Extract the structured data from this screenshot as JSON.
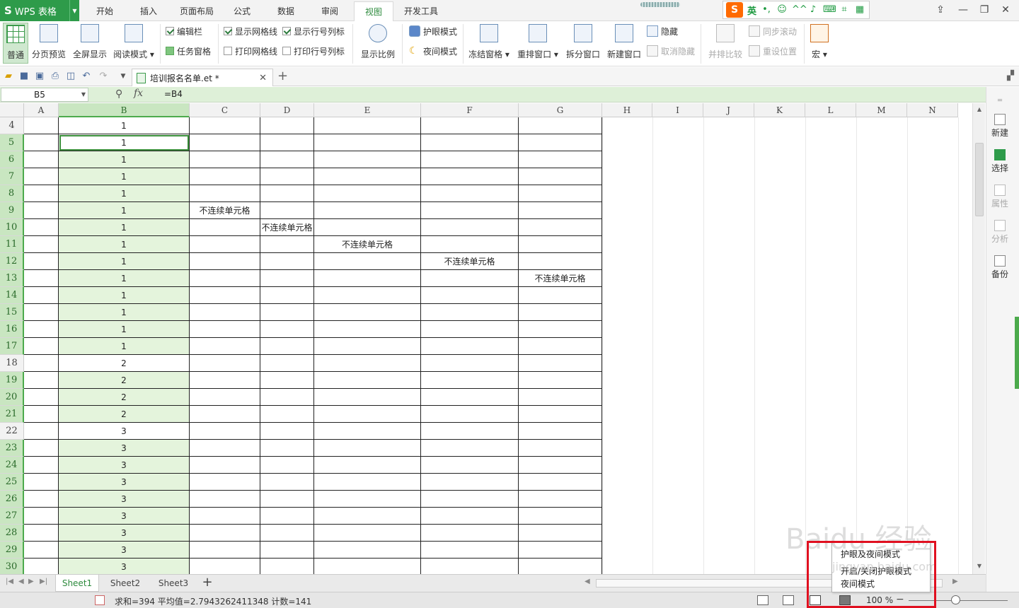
{
  "app": {
    "title": "WPS 表格",
    "logo": "S"
  },
  "menu_tabs": [
    "开始",
    "插入",
    "页面布局",
    "公式",
    "数据",
    "审阅",
    "视图",
    "开发工具"
  ],
  "active_menu_tab": "视图",
  "ime": {
    "mode": "英",
    "icons": [
      "punct-icon",
      "emoji-icon",
      "voice-icon",
      "mic-icon",
      "keyboard-icon",
      "crop-icon",
      "apps-icon"
    ]
  },
  "ribbon": {
    "normal": "普通",
    "page_break_preview": "分页预览",
    "full_screen": "全屏显示",
    "reading_mode": "阅读模式",
    "edit_bar": "编辑栏",
    "task_pane": "任务窗格",
    "show_gridlines": "显示网格线",
    "print_gridlines": "打印网格线",
    "show_headers": "显示行号列标",
    "print_headers": "打印行号列标",
    "zoom_ratio": "显示比例",
    "eye_protect": "护眼模式",
    "night_mode": "夜间模式",
    "freeze_panes": "冻结窗格",
    "arrange_windows": "重排窗口",
    "split_window": "拆分窗口",
    "new_window": "新建窗口",
    "hide": "隐藏",
    "unhide": "取消隐藏",
    "side_by_side": "并排比较",
    "sync_scroll": "同步滚动",
    "reset_position": "重设位置",
    "macro": "宏"
  },
  "document_tab": {
    "name": "培训报名名单.et *"
  },
  "formula_bar": {
    "name_box": "B5",
    "fx": "fx",
    "formula": "=B4"
  },
  "columns": [
    "A",
    "B",
    "C",
    "D",
    "E",
    "F",
    "G",
    "H",
    "I",
    "J",
    "K",
    "L",
    "M",
    "N"
  ],
  "selected_column": "B",
  "rows": [
    {
      "num": "4",
      "b": "1",
      "hl": false
    },
    {
      "num": "5",
      "b": "1",
      "hl": true,
      "active": true
    },
    {
      "num": "6",
      "b": "1",
      "hl": true
    },
    {
      "num": "7",
      "b": "1",
      "hl": true
    },
    {
      "num": "8",
      "b": "1",
      "hl": true
    },
    {
      "num": "9",
      "b": "1",
      "hl": true,
      "c": "不连续单元格"
    },
    {
      "num": "10",
      "b": "1",
      "hl": true,
      "d": "不连续单元格"
    },
    {
      "num": "11",
      "b": "1",
      "hl": true,
      "e": "不连续单元格"
    },
    {
      "num": "12",
      "b": "1",
      "hl": true,
      "f": "不连续单元格"
    },
    {
      "num": "13",
      "b": "1",
      "hl": true,
      "g": "不连续单元格"
    },
    {
      "num": "14",
      "b": "1",
      "hl": true
    },
    {
      "num": "15",
      "b": "1",
      "hl": true
    },
    {
      "num": "16",
      "b": "1",
      "hl": true
    },
    {
      "num": "17",
      "b": "1",
      "hl": true
    },
    {
      "num": "18",
      "b": "2",
      "hl": false
    },
    {
      "num": "19",
      "b": "2",
      "hl": true
    },
    {
      "num": "20",
      "b": "2",
      "hl": true
    },
    {
      "num": "21",
      "b": "2",
      "hl": true
    },
    {
      "num": "22",
      "b": "3",
      "hl": false
    },
    {
      "num": "23",
      "b": "3",
      "hl": true
    },
    {
      "num": "24",
      "b": "3",
      "hl": true
    },
    {
      "num": "25",
      "b": "3",
      "hl": true
    },
    {
      "num": "26",
      "b": "3",
      "hl": true
    },
    {
      "num": "27",
      "b": "3",
      "hl": true
    },
    {
      "num": "28",
      "b": "3",
      "hl": true
    },
    {
      "num": "29",
      "b": "3",
      "hl": true
    },
    {
      "num": "30",
      "b": "3",
      "hl": true
    }
  ],
  "side_panel": {
    "new": "新建",
    "select": "选择",
    "properties": "属性",
    "analyze": "分析",
    "backup": "备份"
  },
  "sheets": [
    "Sheet1",
    "Sheet2",
    "Sheet3"
  ],
  "active_sheet": "Sheet1",
  "status": {
    "summary": "求和=394  平均值=2.7943262411348  计数=141",
    "zoom": "100 %"
  },
  "popup_menu": {
    "items": [
      "护眼及夜间模式",
      "开启/关闭护眼模式",
      "夜间模式"
    ]
  },
  "watermark": {
    "main": "Baidu 经验",
    "sub": "jingyan.baidu.com"
  },
  "colors": {
    "brand_green": "#2e9b4a",
    "selection_fill": "#e4f4dc",
    "formula_bar_bg": "#def0d8",
    "highlight_red": "#e01020"
  }
}
